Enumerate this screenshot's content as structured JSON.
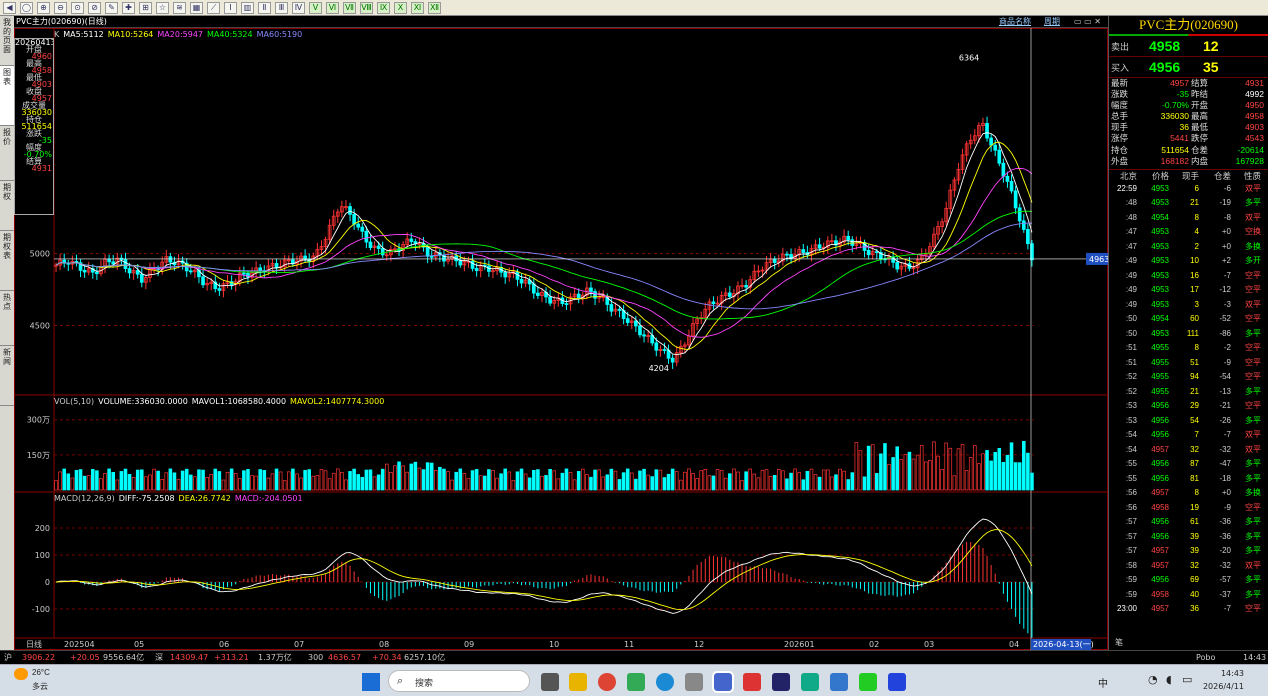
{
  "toolbar": {
    "buttons": [
      "◀",
      "◯",
      "⊕",
      "⊖",
      "⊙",
      "⊘",
      "✎",
      "✚",
      "⊞",
      "☆",
      "≋",
      "▦",
      "⟋",
      "Ⅰ",
      "▥",
      "Ⅱ",
      "Ⅲ",
      "Ⅳ",
      "Ⅴ",
      "Ⅵ",
      "Ⅶ",
      "Ⅷ",
      "Ⅸ",
      "Ⅹ",
      "Ⅺ",
      "Ⅻ"
    ]
  },
  "left_tabs": [
    "我的页面",
    "图表",
    "报价",
    "期权",
    "期权表",
    "热点",
    "新闻"
  ],
  "title": "PVC主力(020690)(日线)",
  "title_right_a": "商品名称",
  "title_right_b": "周期",
  "info_box": [
    {
      "label": "20260413",
      "value": ""
    },
    {
      "label": "开盘",
      "value": "4960"
    },
    {
      "label": "最高",
      "value": "4958"
    },
    {
      "label": "最低",
      "value": "4903"
    },
    {
      "label": "收盘",
      "value": "4957"
    },
    {
      "label": "成交量",
      "value": "336030"
    },
    {
      "label": "持仓",
      "value": "511654"
    },
    {
      "label": "涨跌",
      "value": "-35"
    },
    {
      "label": "幅度",
      "value": "-0.70%"
    },
    {
      "label": "结算",
      "value": "4931"
    }
  ],
  "legend_k": [
    {
      "t": "K",
      "c": "#cccccc"
    },
    {
      "t": "MA5:5112",
      "c": "#ffffff"
    },
    {
      "t": "MA10:5264",
      "c": "#ffff00"
    },
    {
      "t": "MA20:5947",
      "c": "#ff44ff"
    },
    {
      "t": "MA40:5324",
      "c": "#00ff00"
    },
    {
      "t": "MA60:5190",
      "c": "#8888ff"
    }
  ],
  "legend_v": [
    {
      "t": "VOL(5,10)",
      "c": "#cccccc"
    },
    {
      "t": "VOLUME:336030.0000",
      "c": "#ffffff"
    },
    {
      "t": "MAVOL1:1068580.4000",
      "c": "#ffffff"
    },
    {
      "t": "MAVOL2:1407774.3000",
      "c": "#ffff00"
    }
  ],
  "legend_m": [
    {
      "t": "MACD(12,26,9)",
      "c": "#cccccc"
    },
    {
      "t": "DIFF:-75.2508",
      "c": "#ffffff"
    },
    {
      "t": "DEA:26.7742",
      "c": "#ffff00"
    },
    {
      "t": "MACD:-204.0501",
      "c": "#ff44ff"
    }
  ],
  "price_axis": [
    "5000",
    "4500"
  ],
  "vol_axis": [
    "300万",
    "150万"
  ],
  "macd_axis": [
    "200",
    "100",
    "0",
    "-100"
  ],
  "x_axis": [
    "日线",
    "202504",
    "05",
    "06",
    "07",
    "08",
    "09",
    "10",
    "11",
    "12",
    "202601",
    "02",
    "03",
    "04"
  ],
  "annotation_high": "6364",
  "annotation_low": "4204",
  "price_marker": "4963",
  "date_marker": "2026-04-13(一)",
  "panel": {
    "title": "PVC主力(020690)",
    "sell_label": "卖出",
    "sell_price": "4958",
    "sell_vol": "12",
    "buy_label": "买入",
    "buy_price": "4956",
    "buy_vol": "35",
    "stats": [
      [
        "最新",
        "4957",
        "结算",
        "4931"
      ],
      [
        "涨跌",
        "-35",
        "昨结",
        "4992"
      ],
      [
        "幅度",
        "-0.70%",
        "开盘",
        "4950"
      ],
      [
        "总手",
        "336030",
        "最高",
        "4958"
      ],
      [
        "现手",
        "36",
        "最低",
        "4903"
      ],
      [
        "涨停",
        "5441",
        "跌停",
        "4543"
      ],
      [
        "持仓",
        "511654",
        "仓差",
        "-20614"
      ],
      [
        "外盘",
        "168182",
        "内盘",
        "167928"
      ]
    ],
    "tick_head": [
      "北京",
      "价格",
      "现手",
      "仓差",
      "性质"
    ],
    "ticks": [
      [
        "22:59",
        "4953",
        "6",
        "-6",
        "双平"
      ],
      [
        ":48",
        "4953",
        "21",
        "-19",
        "多平"
      ],
      [
        ":48",
        "4954",
        "8",
        "-8",
        "双平"
      ],
      [
        ":47",
        "4953",
        "4",
        "+0",
        "空换"
      ],
      [
        ":47",
        "4953",
        "2",
        "+0",
        "多换"
      ],
      [
        ":49",
        "4953",
        "10",
        "+2",
        "多开"
      ],
      [
        ":49",
        "4953",
        "16",
        "-7",
        "空平"
      ],
      [
        ":49",
        "4953",
        "17",
        "-12",
        "空平"
      ],
      [
        ":49",
        "4953",
        "3",
        "-3",
        "双平"
      ],
      [
        ":50",
        "4954",
        "60",
        "-52",
        "空平"
      ],
      [
        ":50",
        "4953",
        "111",
        "-86",
        "多平"
      ],
      [
        ":51",
        "4955",
        "8",
        "-2",
        "空平"
      ],
      [
        ":51",
        "4955",
        "51",
        "-9",
        "空平"
      ],
      [
        ":52",
        "4955",
        "94",
        "-54",
        "空平"
      ],
      [
        ":52",
        "4955",
        "21",
        "-13",
        "多平"
      ],
      [
        ":53",
        "4956",
        "29",
        "-21",
        "空平"
      ],
      [
        ":53",
        "4956",
        "54",
        "-26",
        "多平"
      ],
      [
        ":54",
        "4956",
        "7",
        "-7",
        "双平"
      ],
      [
        ":54",
        "4957",
        "32",
        "-32",
        "双平"
      ],
      [
        ":55",
        "4956",
        "87",
        "-47",
        "多平"
      ],
      [
        ":55",
        "4956",
        "81",
        "-18",
        "多平"
      ],
      [
        ":56",
        "4957",
        "8",
        "+0",
        "多换"
      ],
      [
        ":56",
        "4958",
        "19",
        "-9",
        "空平"
      ],
      [
        ":57",
        "4956",
        "61",
        "-36",
        "多平"
      ],
      [
        ":57",
        "4956",
        "39",
        "-36",
        "多平"
      ],
      [
        ":57",
        "4957",
        "39",
        "-20",
        "多平"
      ],
      [
        ":58",
        "4957",
        "32",
        "-32",
        "双平"
      ],
      [
        ":59",
        "4956",
        "69",
        "-57",
        "多平"
      ],
      [
        ":59",
        "4958",
        "40",
        "-37",
        "多平"
      ],
      [
        "23:00",
        "4957",
        "36",
        "-7",
        "空平"
      ]
    ],
    "footer": "笔"
  },
  "status": {
    "a": "沪",
    "b": "3906.22",
    "c": "+20.05",
    "d": "9556.64亿",
    "e": "深",
    "f": "14309.47",
    "g": "+313.21",
    "h": "1.37万亿",
    "i": "300",
    "j": "4636.57",
    "k": "+70.34",
    "l": "6257.10亿",
    "right": "Pobo",
    "time": "14:43"
  },
  "taskbar": {
    "weather_temp": "26°C",
    "weather_desc": "多云",
    "search": "搜索",
    "clock_time": "14:43",
    "clock_date": "2026/4/11",
    "ime": "中"
  },
  "chart_data": {
    "type": "candlestick",
    "title": "PVC主力(020690)(日线)",
    "ylim": [
      4100,
      6500
    ],
    "high": 6364,
    "low": 4204,
    "close_series": [
      4920,
      4950,
      4900,
      4860,
      4940,
      4960,
      4880,
      4820,
      4900,
      4960,
      4930,
      4880,
      4800,
      4760,
      4790,
      4850,
      4870,
      4900,
      4920,
      4950,
      4960,
      4980,
      5150,
      5350,
      5250,
      5100,
      5020,
      5000,
      5060,
      5100,
      5000,
      4980,
      4960,
      4940,
      4900,
      4900,
      4870,
      4850,
      4800,
      4720,
      4680,
      4660,
      4700,
      4740,
      4700,
      4620,
      4560,
      4480,
      4400,
      4320,
      4260,
      4400,
      4560,
      4650,
      4700,
      4740,
      4800,
      4900,
      4950,
      4980,
      5000,
      5020,
      5060,
      5080,
      5100,
      5060,
      5000,
      4980,
      4920,
      4900,
      4960,
      5100,
      5300,
      5600,
      5800,
      5900,
      5700,
      5500,
      5250,
      4957
    ]
  }
}
